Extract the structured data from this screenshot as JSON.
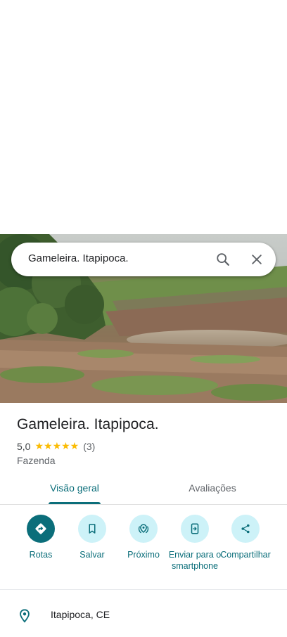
{
  "search": {
    "query": "Gameleira. Itapipoca."
  },
  "place": {
    "title": "Gameleira. Itapipoca.",
    "rating_value": "5,0",
    "stars": "★★★★★",
    "review_count": "(3)",
    "category": "Fazenda",
    "address": "Itapipoca, CE"
  },
  "tabs": [
    {
      "label": "Visão geral",
      "active": true
    },
    {
      "label": "Avaliações",
      "active": false
    }
  ],
  "actions": [
    {
      "label": "Rotas",
      "icon": "directions-icon"
    },
    {
      "label": "Salvar",
      "icon": "bookmark-icon"
    },
    {
      "label": "Próximo",
      "icon": "nearby-icon"
    },
    {
      "label": "Enviar para o smartphone",
      "icon": "send-to-phone-icon"
    },
    {
      "label": "Compartilhar",
      "icon": "share-icon"
    }
  ],
  "colors": {
    "accent": "#0b6e7a",
    "action_bg": "#cdf2f8",
    "star": "#fbbc04"
  }
}
